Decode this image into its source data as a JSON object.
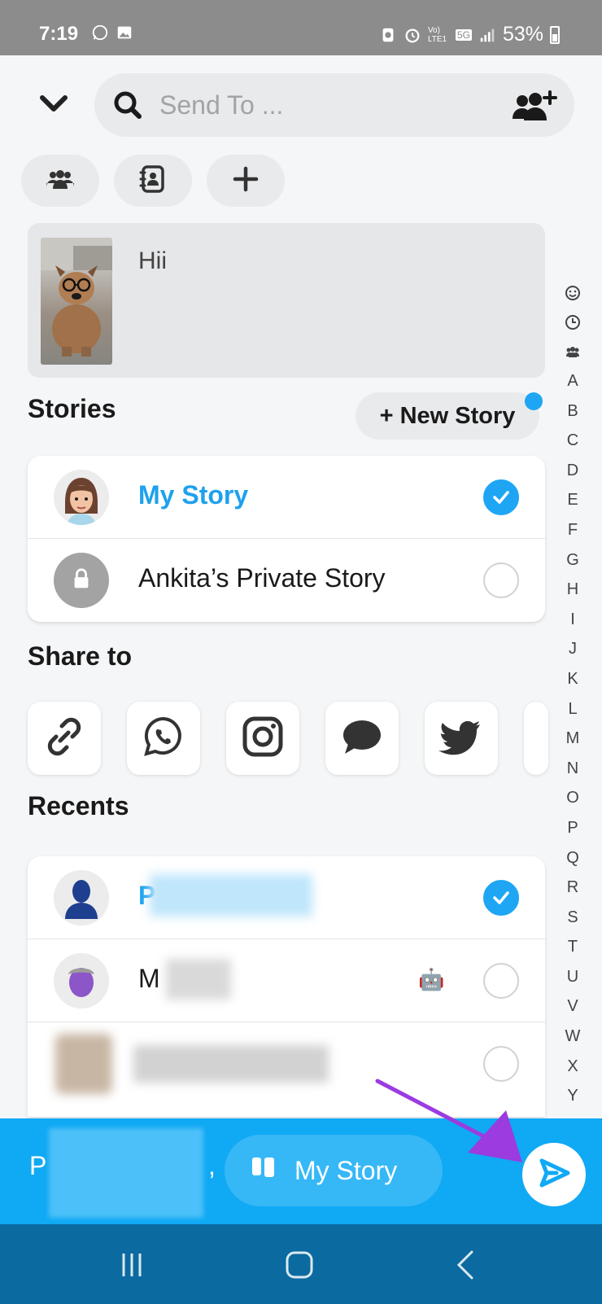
{
  "status_bar": {
    "time": "7:19",
    "battery": "53%",
    "network_label": "5G",
    "volte_label": "Vo) LTE1"
  },
  "search": {
    "placeholder": "Send To ..."
  },
  "snap": {
    "caption": "Hii"
  },
  "stories": {
    "title": "Stories",
    "new_story_label": "+ New Story",
    "items": [
      {
        "label": "My Story",
        "checked": true,
        "highlight": true
      },
      {
        "label": "Ankita’s Private Story",
        "checked": false
      }
    ]
  },
  "share_to": {
    "title": "Share to",
    "targets": [
      "link-icon",
      "whatsapp-icon",
      "instagram-icon",
      "messages-icon",
      "twitter-icon"
    ]
  },
  "recents": {
    "title": "Recents",
    "items": [
      {
        "label": "P",
        "checked": true,
        "highlight": true
      },
      {
        "label": "M",
        "checked": false,
        "badge": "🤖"
      },
      {
        "label": "",
        "checked": false
      }
    ]
  },
  "alphabet_index": [
    "A",
    "B",
    "C",
    "D",
    "E",
    "F",
    "G",
    "H",
    "I",
    "J",
    "K",
    "L",
    "M",
    "N",
    "O",
    "P",
    "Q",
    "R",
    "S",
    "T",
    "U",
    "V",
    "W",
    "X",
    "Y"
  ],
  "send_bar": {
    "recipient_initial": "P",
    "separator": ",",
    "story_label": "My Story"
  },
  "colors": {
    "accent": "#1ea6f5",
    "send_bar": "#10a9f4",
    "nav_bar": "#0b6aa0",
    "annotation_arrow": "#9b3be0"
  }
}
